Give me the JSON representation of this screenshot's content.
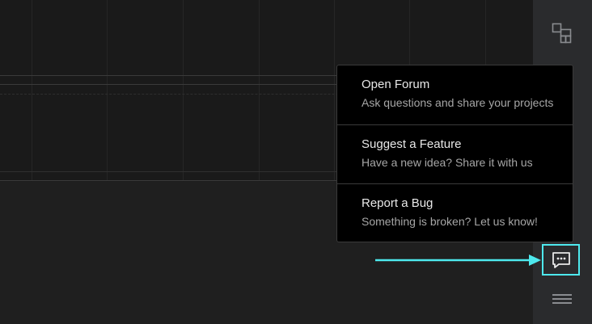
{
  "popup_menu": {
    "items": [
      {
        "title": "Open Forum",
        "subtitle": "Ask questions and share your projects"
      },
      {
        "title": "Suggest a Feature",
        "subtitle": "Have a new idea? Share it with us"
      },
      {
        "title": "Report a Bug",
        "subtitle": "Something is broken? Let us know!"
      }
    ]
  },
  "sidebar": {
    "icons": [
      "layout-icon",
      "chat-icon",
      "hamburger-menu-icon"
    ]
  },
  "colors": {
    "highlight": "#4ee9ee",
    "popup_bg": "#000000",
    "sidebar_bg": "#2a2b2d"
  }
}
